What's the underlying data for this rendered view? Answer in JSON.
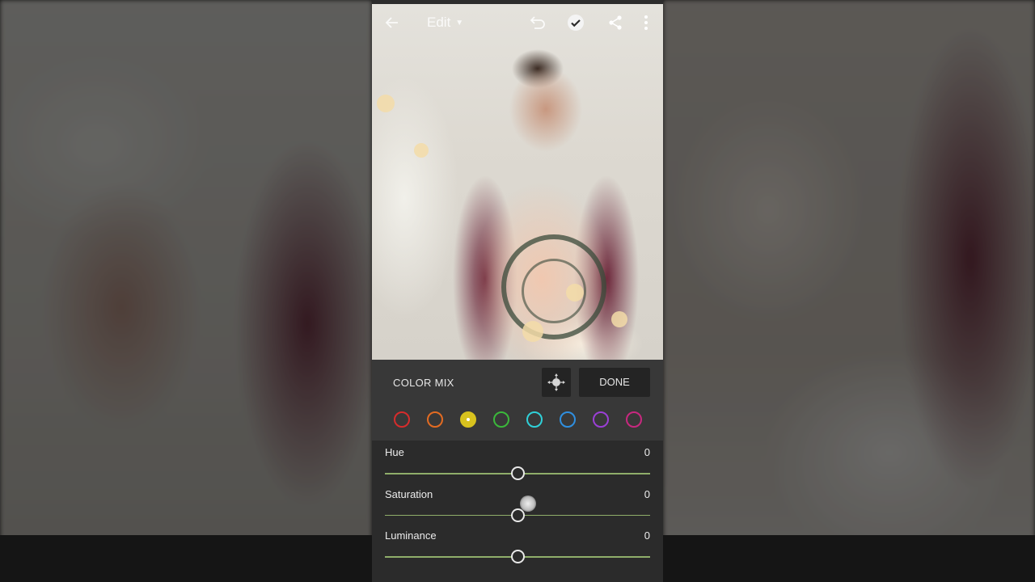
{
  "toolbar": {
    "mode_label": "Edit",
    "icons": [
      "back-arrow-icon",
      "chevron-down-icon",
      "undo-icon",
      "check-icon",
      "share-icon",
      "more-vertical-icon"
    ]
  },
  "panel": {
    "title": "COLOR MIX",
    "done_label": "DONE",
    "target_icon": "target-adjust-icon"
  },
  "swatches": [
    {
      "name": "red",
      "color": "#d62c2c",
      "selected": false
    },
    {
      "name": "orange",
      "color": "#e36b22",
      "selected": false
    },
    {
      "name": "yellow",
      "color": "#d8c21e",
      "selected": true
    },
    {
      "name": "green",
      "color": "#3bb83b",
      "selected": false
    },
    {
      "name": "aqua",
      "color": "#2fd0d8",
      "selected": false
    },
    {
      "name": "blue",
      "color": "#2f8fe0",
      "selected": false
    },
    {
      "name": "purple",
      "color": "#9b3fd6",
      "selected": false
    },
    {
      "name": "magenta",
      "color": "#c8287f",
      "selected": false
    }
  ],
  "sliders": [
    {
      "label": "Hue",
      "value": "0",
      "position": 0.5
    },
    {
      "label": "Saturation",
      "value": "0",
      "position": 0.5
    },
    {
      "label": "Luminance",
      "value": "0",
      "position": 0.5
    }
  ],
  "colors": {
    "track": "#8fae6a",
    "panel_bg": "#383838",
    "slider_bg": "#2b2b2b"
  }
}
